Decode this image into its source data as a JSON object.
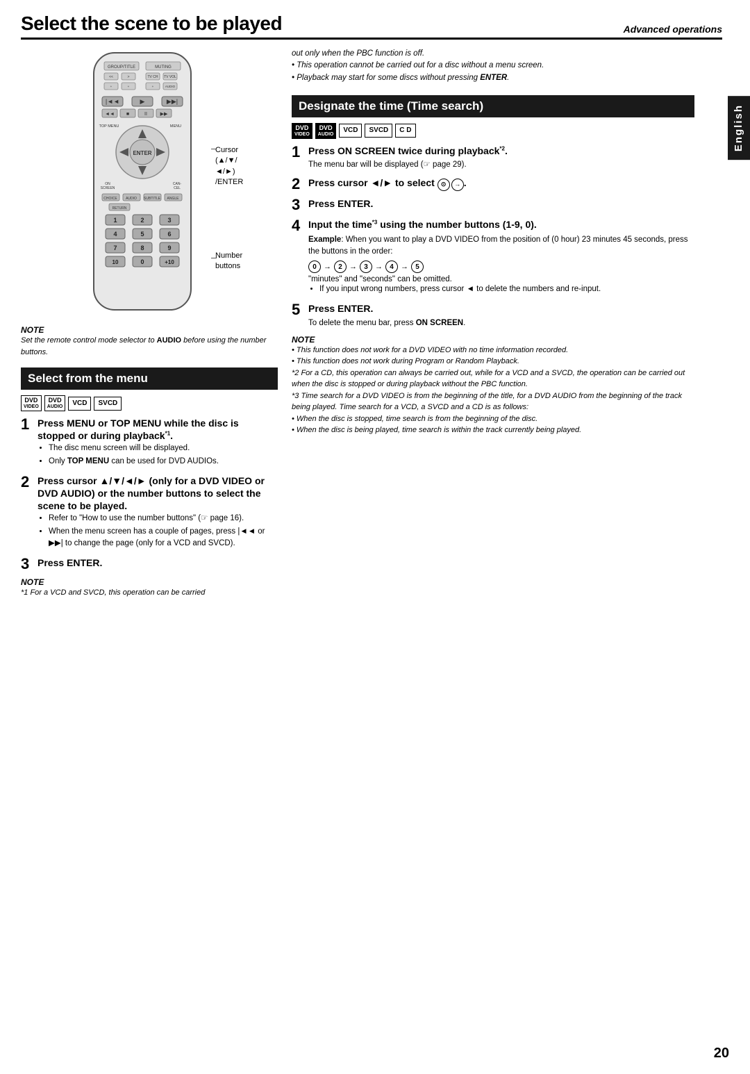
{
  "page": {
    "number": "20",
    "lang_tab": "English"
  },
  "header": {
    "title": "Select the scene to be played",
    "subtitle": "Advanced operations"
  },
  "left_col": {
    "note_above": {
      "title": "NOTE",
      "lines": [
        "Set the remote control mode selector to",
        "AUDIO before using the number buttons."
      ]
    },
    "section1": {
      "header": "Select from the menu",
      "badges": [
        "DVD VIDEO",
        "DVD AUDIO",
        "VCD",
        "SVCD"
      ],
      "steps": [
        {
          "num": "1",
          "title": "Press MENU or TOP MENU while the disc is stopped or during playback*1.",
          "bullets": [
            "The disc menu screen will be displayed.",
            "Only TOP MENU can be used for DVD AUDIOs."
          ]
        },
        {
          "num": "2",
          "title": "Press cursor ▲/▼/◄/► (only for a DVD VIDEO or DVD AUDIO) or the number buttons to select the scene to be played.",
          "bullets": [
            "Refer to \"How to use the number buttons\" (☞ page 16).",
            "When the menu screen has a couple of pages, press |◄◄ or ▶▶| to change the page (only for a VCD and SVCD)."
          ]
        },
        {
          "num": "3",
          "title": "Press ENTER.",
          "bullets": []
        }
      ],
      "note": {
        "title": "NOTE",
        "text": "*1 For a VCD and SVCD, this operation can be carried"
      }
    }
  },
  "right_col": {
    "top_note_lines": [
      "out only when the PBC function is off.",
      "• This operation cannot be carried out for a disc without a menu screen.",
      "• Playback may start for some discs without pressing ENTER."
    ],
    "section2": {
      "header": "Designate the time (Time search)",
      "badges": [
        "DVD VIDEO",
        "DVD AUDIO",
        "VCD",
        "SVCD",
        "C D"
      ],
      "steps": [
        {
          "num": "1",
          "title": "Press ON SCREEN twice during playback*2.",
          "body": "The menu bar will be displayed (☞ page 29)."
        },
        {
          "num": "2",
          "title": "Press cursor ◄/► to select 🕐."
        },
        {
          "num": "3",
          "title": "Press ENTER."
        },
        {
          "num": "4",
          "title": "Input the time*3 using the number buttons (1-9, 0).",
          "example": {
            "label": "Example",
            "text": ": When you want to play a DVD VIDEO from the position of (0 hour) 23 minutes 45 seconds, press the buttons in the order:",
            "sequence": [
              "0",
              "2",
              "3",
              "4",
              "5"
            ],
            "note": "\"minutes\" and \"seconds\" can be omitted."
          },
          "bullet": "If you input wrong numbers, press cursor ◄ to delete the numbers and re-input."
        },
        {
          "num": "5",
          "title": "Press ENTER.",
          "body": "To delete the menu bar, press ON SCREEN."
        }
      ],
      "note": {
        "title": "NOTE",
        "bullets": [
          "This function does not work for a DVD VIDEO with no time information recorded.",
          "This function does not work during Program or Random Playback.",
          "*2 For a CD, this operation can always be carried out, while for a VCD and a SVCD, the operation can be carried out when the disc is stopped or during playback without the PBC function.",
          "*3 Time search for a DVD VIDEO is from the beginning of the title, for a DVD AUDIO from the beginning of the track being played. Time search for a VCD, a SVCD and a CD is as follows:",
          "• When the disc is stopped, time search is from the beginning of the disc.",
          "• When the disc is being played, time search is within the track currently being played."
        ]
      }
    }
  },
  "remote": {
    "cursor_label": "Cursor (▲/▼/◄/►) /ENTER",
    "number_label": "Number buttons"
  }
}
